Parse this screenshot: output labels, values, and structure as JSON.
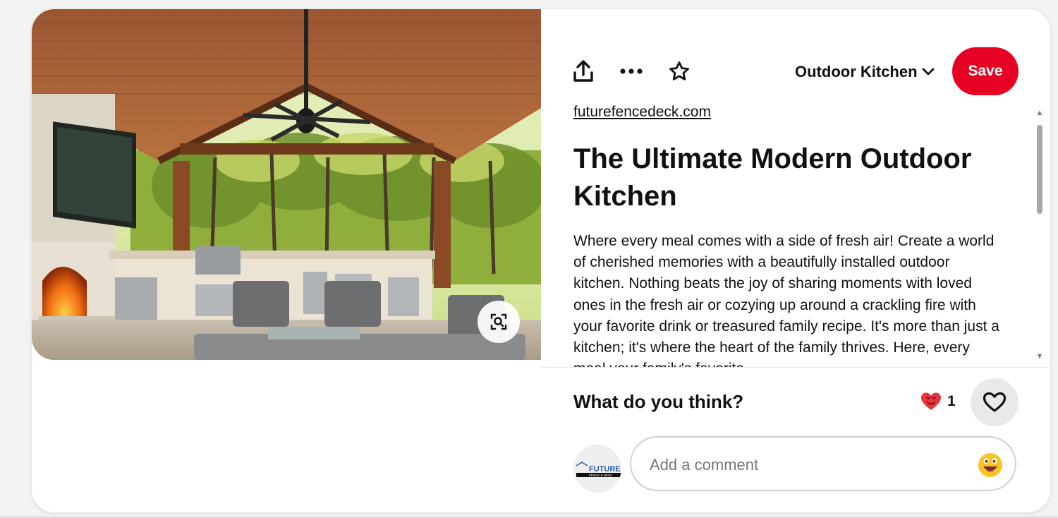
{
  "pin": {
    "image_alt": "Covered outdoor kitchen with cedar ceiling, ceiling fan, fireplace, TV, grill and lounge seating",
    "board": "Outdoor Kitchen",
    "save_label": "Save",
    "source": "futurefencedeck.com",
    "title": "The Ultimate Modern Outdoor Kitchen",
    "description": "Where every meal comes with a side of fresh air! Create a world of cherished memories with a beautifully installed outdoor kitchen. Nothing beats the joy of sharing moments with loved ones in the fresh air or cozying up around a crackling fire with your favorite drink or treasured family recipe. It's more than just a kitchen; it's where the heart of the family thrives. Here, every meal your family's favorite"
  },
  "feedback": {
    "label": "What do you think?",
    "reaction_count": "1"
  },
  "comment": {
    "placeholder": "Add a comment"
  },
  "avatar": {
    "brand_line1": "FUTURE",
    "brand_line2": "FENCE & DECK"
  },
  "icons": {
    "share": "share-icon",
    "more": "more-icon",
    "favorite": "star-icon",
    "board_dropdown": "chevron-down-icon",
    "visual_search": "lens-search-icon",
    "reaction": "heart-eyes-icon",
    "react_button": "heart-icon",
    "emoji": "emoji-icon"
  },
  "colors": {
    "save_button": "#e60023",
    "reaction_heart": "#e8343c",
    "emoji": "#f7c325"
  }
}
